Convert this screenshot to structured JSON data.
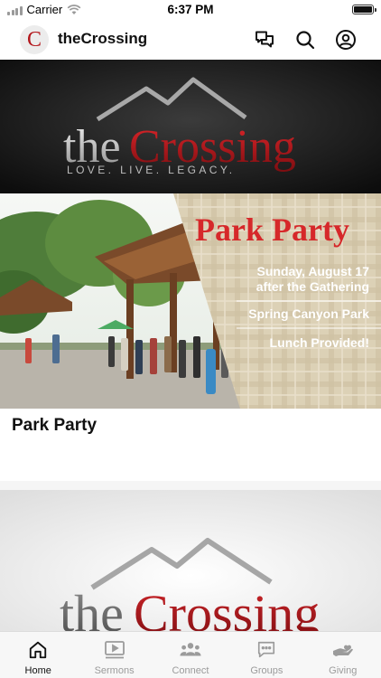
{
  "status_bar": {
    "carrier": "Carrier",
    "time": "6:37 PM"
  },
  "header": {
    "logo_letter": "C",
    "title": "theCrossing",
    "icons": [
      "chat-icon",
      "search-icon",
      "profile-icon"
    ]
  },
  "banner": {
    "brand_the": "the",
    "brand_crossing": "Crossing",
    "tagline": "LOVE. LIVE. LEGACY."
  },
  "event": {
    "headline": "Park Party",
    "date_line1": "Sunday, August 17",
    "date_line2": "after the Gathering",
    "location": "Spring Canyon Park",
    "note": "Lunch Provided!",
    "card_title": "Park Party"
  },
  "bottom_banner": {
    "brand_the": "the",
    "brand_crossing": "Crossing"
  },
  "tabs": [
    {
      "label": "Home",
      "icon": "home-icon",
      "active": true
    },
    {
      "label": "Sermons",
      "icon": "video-icon",
      "active": false
    },
    {
      "label": "Connect",
      "icon": "people-icon",
      "active": false
    },
    {
      "label": "Groups",
      "icon": "message-icon",
      "active": false
    },
    {
      "label": "Giving",
      "icon": "giving-hand-icon",
      "active": false
    }
  ],
  "colors": {
    "brand_red": "#b3161b",
    "active_tab": "#111111",
    "inactive_tab": "#9b9b9b"
  }
}
